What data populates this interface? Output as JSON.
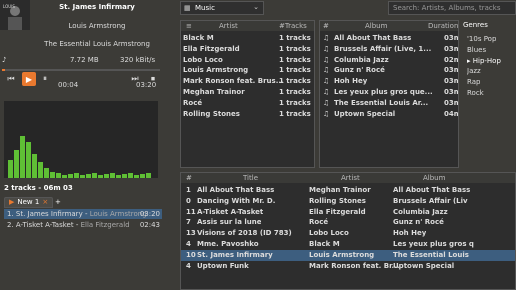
{
  "now_playing": {
    "title": "St. James Infirmary",
    "artist": "Louis Armstrong",
    "album": "The Essential Louis Armstrong",
    "size": "7.72 MB",
    "bitrate": "320 kBit/s",
    "elapsed": "00:04",
    "duration": "03:20",
    "progress": 0.02
  },
  "controls": [
    "prev",
    "play",
    "pause",
    "next",
    "stop"
  ],
  "playlist_summary": "2 tracks - 06m 03",
  "playlist_tabs": {
    "active": "New 1",
    "add": "+"
  },
  "playlist": [
    {
      "n": "1.",
      "title": "St. James Infirmary",
      "artist": "Louis Armstrong",
      "dur": "03:20",
      "selected": true
    },
    {
      "n": "2.",
      "title": "A-Tisket A-Tasket",
      "artist": "Ella Fitzgerald",
      "dur": "02:43",
      "selected": false
    }
  ],
  "search": {
    "mode": "Music",
    "placeholder": "Search: Artists, Albums, tracks"
  },
  "artist_pane": {
    "headers": [
      "Artist",
      "#Tracks"
    ],
    "rows": [
      [
        "Black M",
        "1 tracks"
      ],
      [
        "Ella Fitzgerald",
        "1 tracks"
      ],
      [
        "Lobo Loco",
        "1 tracks"
      ],
      [
        "Louis Armstrong",
        "1 tracks"
      ],
      [
        "Mark Ronson feat. Brus...",
        "1 tracks"
      ],
      [
        "Meghan Trainor",
        "1 tracks"
      ],
      [
        "Rocé",
        "1 tracks"
      ],
      [
        "Rolling Stones",
        "1 tracks"
      ]
    ]
  },
  "album_pane": {
    "headers": [
      "#",
      "Album",
      "Duration"
    ],
    "rows": [
      [
        "All About That Bass",
        "03m"
      ],
      [
        "Brussels Affair (Live, 1...",
        "03m"
      ],
      [
        "Columbia Jazz",
        "02m"
      ],
      [
        "Gunz n' Rocé",
        "03m"
      ],
      [
        "Hoh Hey",
        "03m"
      ],
      [
        "Les yeux plus gros que...",
        "03m"
      ],
      [
        "The Essential Louis Ar...",
        "03m"
      ],
      [
        "Uptown Special",
        "04m"
      ]
    ]
  },
  "genre_pane": {
    "header": "Genres",
    "rows": [
      "'10s Pop",
      "Blues",
      "Hip-Hop",
      "Jazz",
      "Rap",
      "Rock"
    ],
    "selected": "Hip-Hop"
  },
  "tracks": {
    "headers": [
      "#",
      "Title",
      "Artist",
      "Album"
    ],
    "rows": [
      [
        "1",
        "All About That Bass",
        "Meghan Trainor",
        "All About That Bass"
      ],
      [
        "0",
        "Dancing With Mr. D.",
        "Rolling Stones",
        "Brussels Affair (Liv"
      ],
      [
        "11",
        "A-Tisket A-Tasket",
        "Ella Fitzgerald",
        "Columbia Jazz"
      ],
      [
        "7",
        "Assis sur la lune",
        "Rocé",
        "Gunz n' Rocé"
      ],
      [
        "13",
        "Visions of 2018 (ID 783)",
        "Lobo Loco",
        "Hoh Hey"
      ],
      [
        "4",
        "Mme. Pavoshko",
        "Black M",
        "Les yeux plus gros q"
      ],
      [
        "10",
        "St. James Infirmary",
        "Louis Armstrong",
        "The Essential Louis"
      ],
      [
        "4",
        "Uptown Funk",
        "Mark Ronson feat. Br...",
        "Uptown Special"
      ]
    ],
    "selected_index": 6
  }
}
